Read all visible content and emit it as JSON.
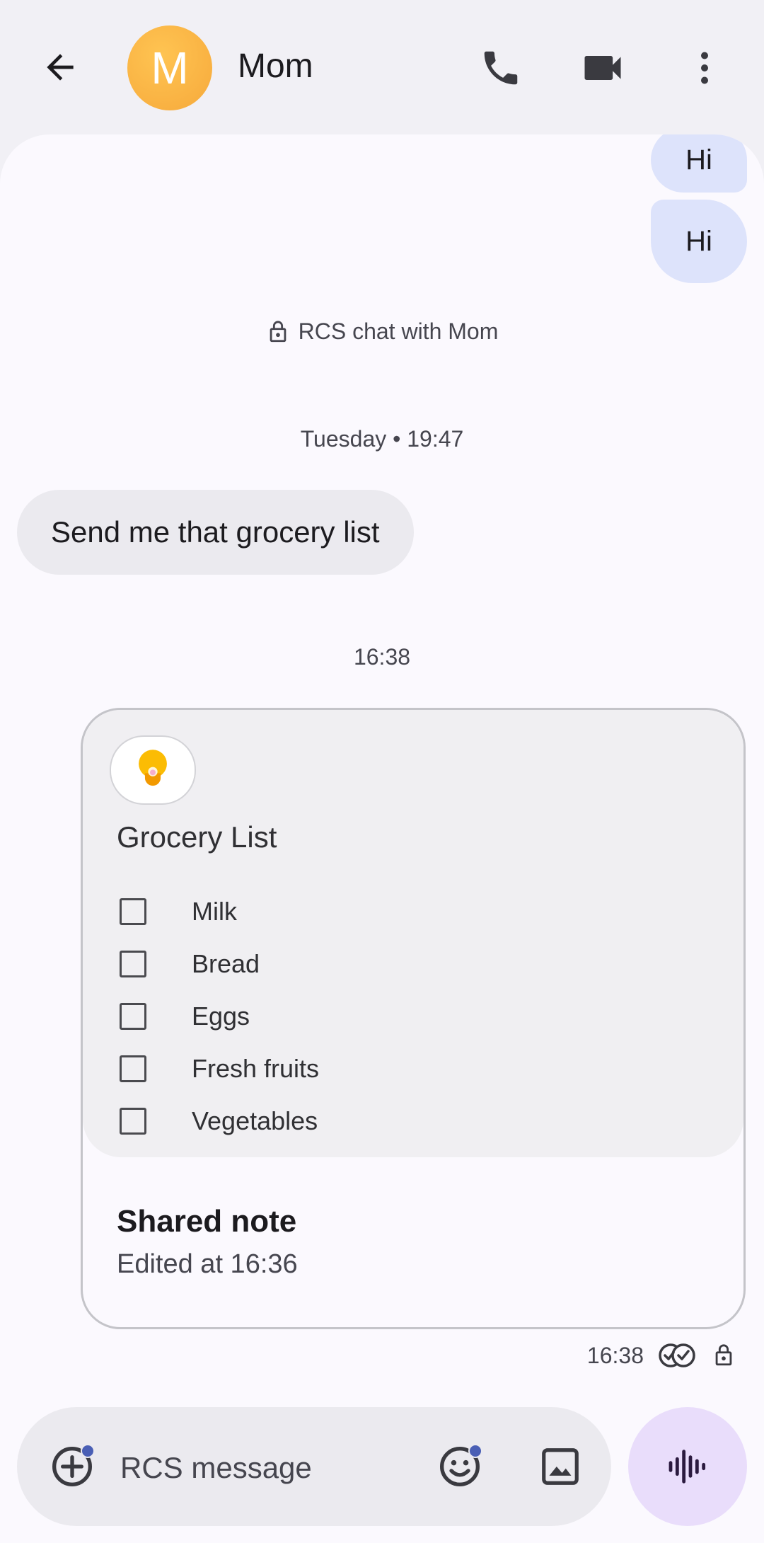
{
  "header": {
    "avatar_letter": "M",
    "contact_name": "Mom"
  },
  "messages": {
    "outgoing_1": "Hi",
    "outgoing_2": "Hi",
    "rcs_notice": "RCS chat with Mom",
    "date_separator": "Tuesday • 19:47",
    "incoming_1": "Send me that grocery list",
    "time_separator": "16:38"
  },
  "note": {
    "title": "Grocery List",
    "items": [
      "Milk",
      "Bread",
      "Eggs",
      "Fresh fruits",
      "Vegetables"
    ],
    "footer_title": "Shared note",
    "footer_subtitle": "Edited at 16:36"
  },
  "status": {
    "time": "16:38"
  },
  "compose": {
    "placeholder": "RCS message"
  },
  "colors": {
    "avatar": "#f6a93b",
    "outgoing_bubble": "#dde3fb",
    "incoming_bubble": "#ebeaef",
    "voice_button": "#e9ddfb"
  }
}
